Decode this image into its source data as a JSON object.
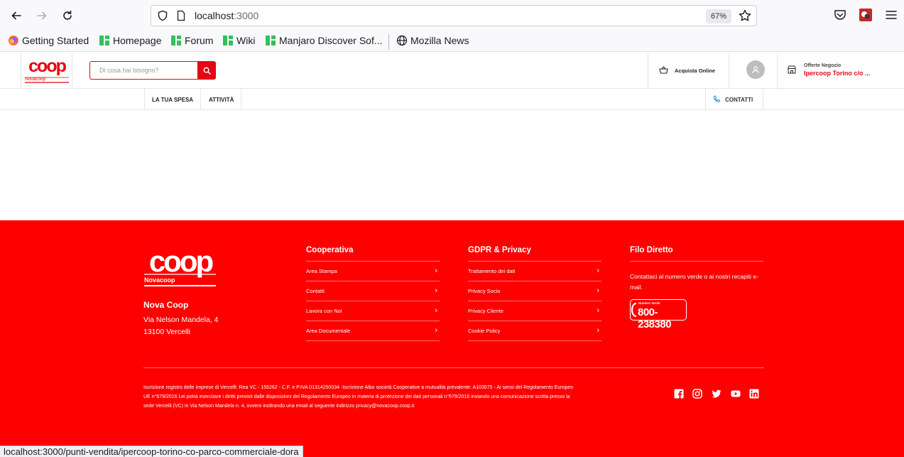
{
  "browser": {
    "url_host": "localhost",
    "url_port": ":3000",
    "zoom": "67%",
    "bookmarks": [
      {
        "label": "Getting Started",
        "icon": "firefox-icon"
      },
      {
        "label": "Homepage",
        "icon": "manjaro-icon"
      },
      {
        "label": "Forum",
        "icon": "manjaro-icon"
      },
      {
        "label": "Wiki",
        "icon": "manjaro-icon"
      },
      {
        "label": "Manjaro Discover Sof...",
        "icon": "manjaro-icon"
      },
      {
        "label": "Mozilla News",
        "icon": "globe-icon"
      }
    ],
    "status_url": "localhost:3000/punti-vendita/ipercoop-torino-co-parco-commerciale-dora"
  },
  "header": {
    "logo_text": "coop",
    "logo_sub": "Novacoop",
    "search_placeholder": "Di cosa hai bisogno?",
    "buy_online": "Acquista Online",
    "offers_label": "Offerte Negozio",
    "offers_store": "Ipercoop Torino c/o ..."
  },
  "subnav": {
    "items": [
      "LA TUA SPESA",
      "ATTIVITÀ"
    ],
    "contacts": "CONTATTI"
  },
  "footer": {
    "logo_text": "coop",
    "logo_sub": "Novacoop",
    "company": "Nova Coop",
    "address_line1": "Via Nelson Mandela, 4",
    "address_line2": "13100 Vercelli",
    "columns": [
      {
        "title": "Cooperativa",
        "links": [
          "Area Stampa",
          "Contatti",
          "Lavora con Noi",
          "Area Documentale"
        ]
      },
      {
        "title": "GDPR & Privacy",
        "links": [
          "Trattamento dei dati",
          "Privacy Socio",
          "Privacy Cliente",
          "Cookie Policy"
        ]
      }
    ],
    "direct": {
      "title": "Filo Diretto",
      "text": "Contattaci al numero verde o ai nostri recapiti e-mail.",
      "phone_label": "Numero Verde",
      "phone": "800-238380"
    },
    "legal": "Iscrizione registro delle Imprese di Vercelli: Rea VC - 155262 - C.F. e P.IVA 01314250034 -Iscrizione Albo società Cooperative a mutualità prevalente: A103575 - Ai sensi del Regolamento Europeo UE n°679/2016 Lei potrà esercitare i diritti previsti dalle disposizioni del Regolamento Europeo in materia di protezione dei dati personali n°679/2016 inviando una comunicazione scritta presso la sede Vercelli (VC) in Via Nelson Mandela n. 4, ovvero inoltrando una email al seguente indirizzo privacy@novacoop.coop.it",
    "social": [
      "facebook-icon",
      "instagram-icon",
      "twitter-icon",
      "youtube-icon",
      "linkedin-icon"
    ]
  },
  "colors": {
    "brand_red": "#e30613",
    "footer_red": "#fe0000"
  }
}
